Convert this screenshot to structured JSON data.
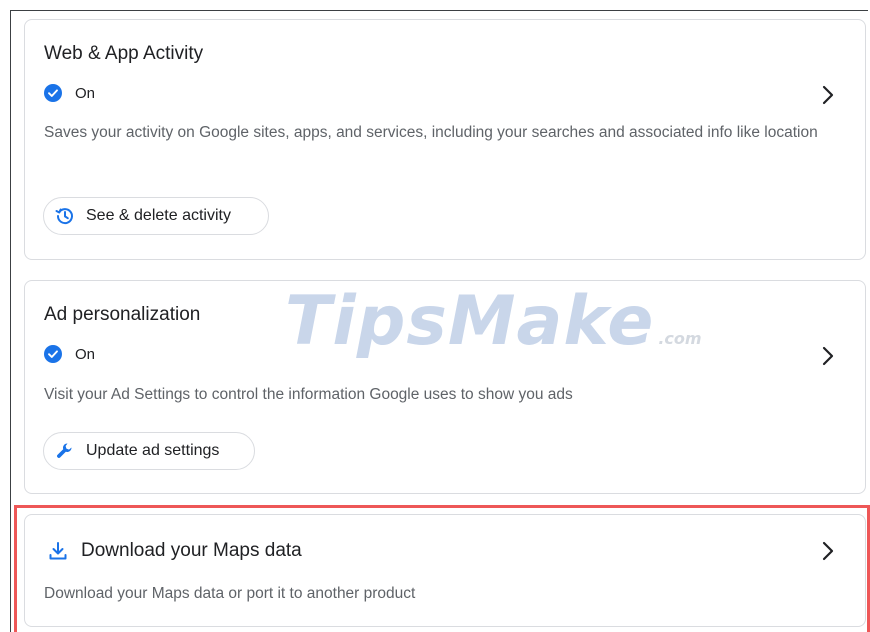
{
  "cards": {
    "web_app_activity": {
      "title": "Web & App Activity",
      "status": "On",
      "description": "Saves your activity on Google sites, apps, and services, including your searches and associated info like location",
      "action_label": "See & delete activity",
      "action_icon": "history-icon"
    },
    "ad_personalization": {
      "title": "Ad personalization",
      "status": "On",
      "description": "Visit your Ad Settings to control the information Google uses to show you ads",
      "action_label": "Update ad settings",
      "action_icon": "wrench-icon"
    },
    "download_maps": {
      "title": "Download your Maps data",
      "description": "Download your Maps data or port it to another product",
      "icon": "download-icon"
    }
  },
  "watermark": {
    "main": "TipsMake",
    "domain": ".com"
  },
  "colors": {
    "accent": "#1a73e8",
    "highlight": "#ee5757",
    "border": "#dadce0",
    "secondary_text": "#5f6368"
  }
}
